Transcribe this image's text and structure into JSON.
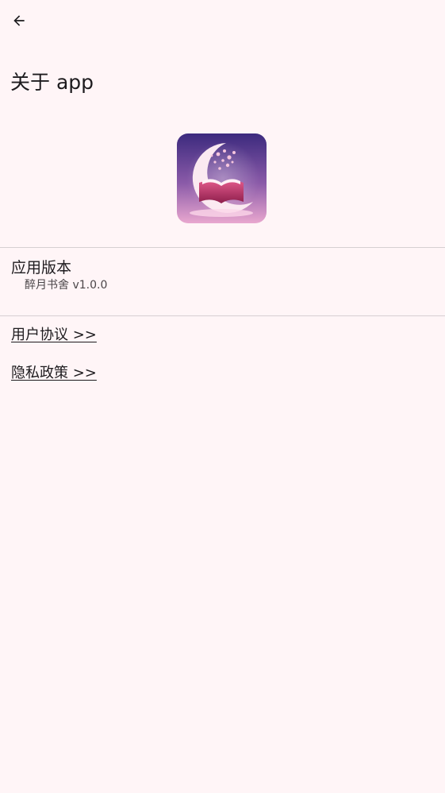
{
  "header": {
    "back_icon": "arrow-left-icon",
    "title": "关于 app"
  },
  "app_icon": {
    "icon": "moon-book-icon",
    "colors": {
      "bg_top": "#3c2a7e",
      "bg_bottom": "#e9a7cf",
      "moon": "#fbe9f1",
      "book": "#c43a6a"
    }
  },
  "version": {
    "label": "应用版本",
    "value": "醉月书舍 v1.0.0"
  },
  "links": {
    "user_agreement": "用户协议 >>",
    "privacy_policy": "隐私政策 >>"
  },
  "colors": {
    "background": "#fff5f7",
    "text": "#1d1b1e",
    "divider": "#d6cfd2"
  }
}
